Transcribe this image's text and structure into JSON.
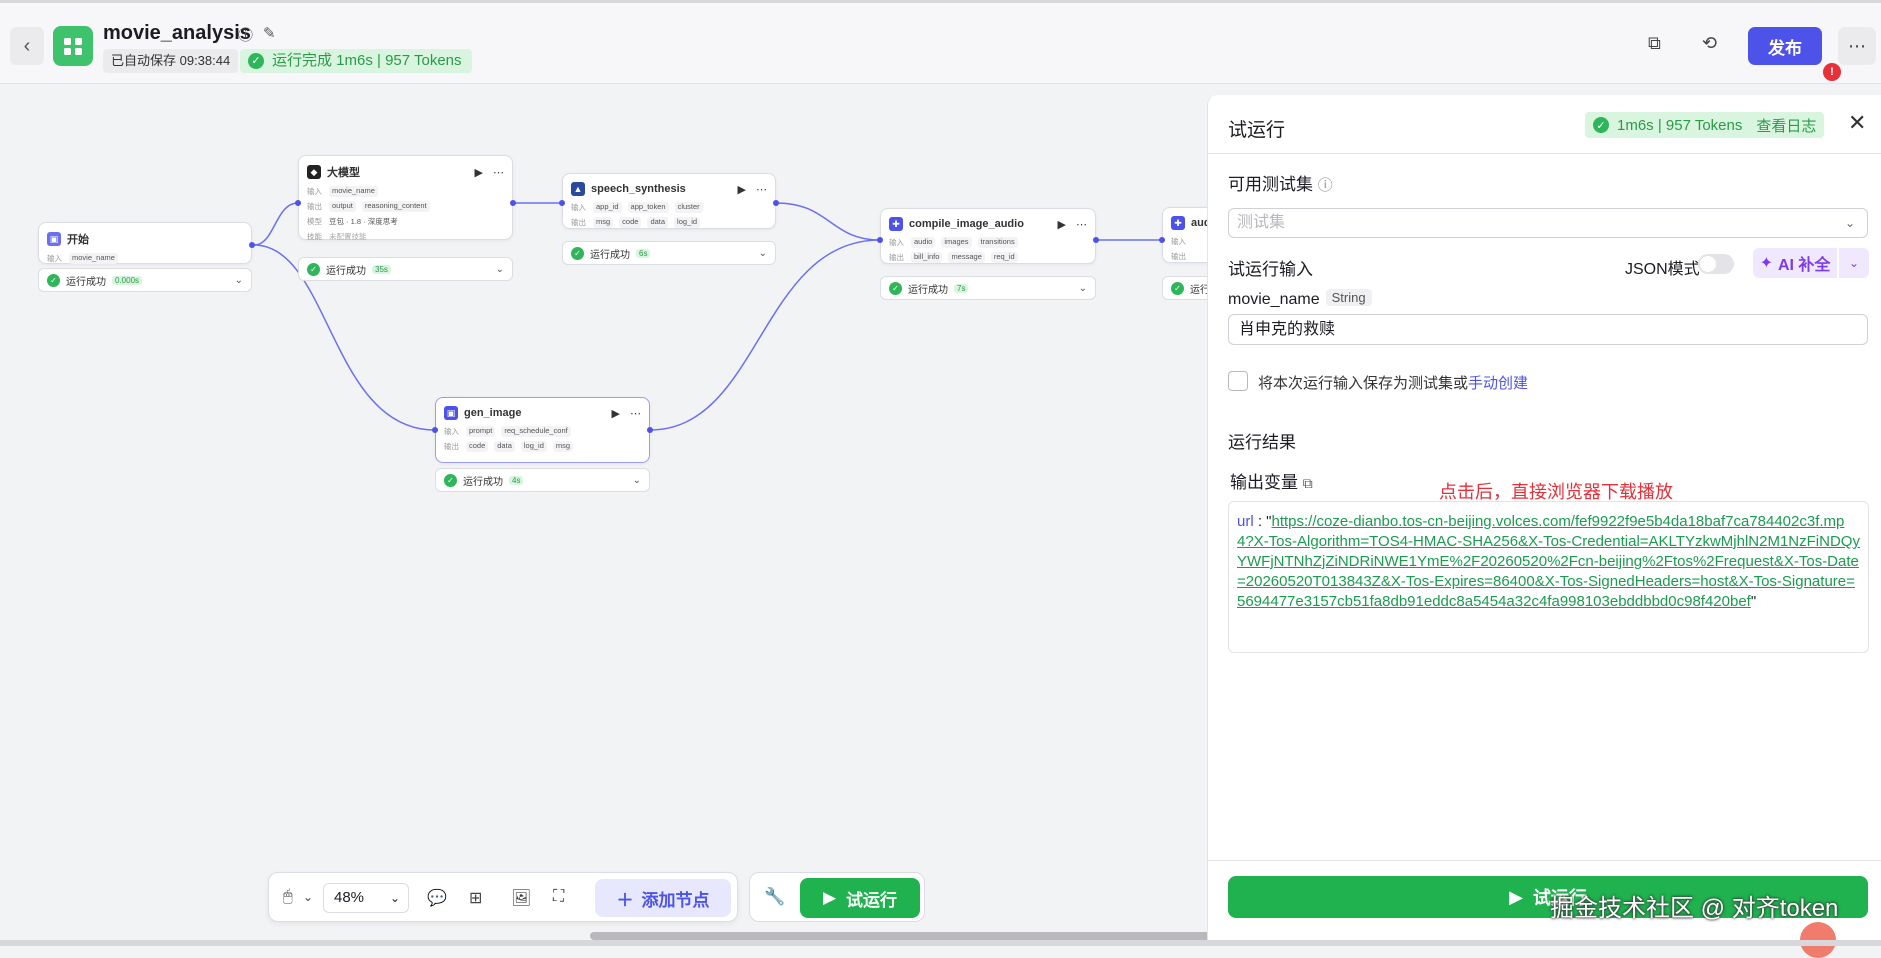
{
  "header": {
    "title": "movie_analysis",
    "autosave": "已自动保存 09:38:44",
    "run_status": "运行完成 1m6s | 957 Tokens",
    "publish": "发布",
    "alert": "!"
  },
  "nodes": {
    "start": {
      "title": "开始",
      "in_label": "输入",
      "in_var": "movie_name",
      "status": "运行成功",
      "time": "0.000s"
    },
    "llm": {
      "title": "大模型",
      "in_label": "输入",
      "in_var": "movie_name",
      "out_label": "输出",
      "out1": "output",
      "out2": "reasoning_content",
      "model_label": "模型",
      "model": "豆包 · 1.8 · 深度思考",
      "skill_label": "技能",
      "skill": "未配置技能",
      "status": "运行成功",
      "time": "35s"
    },
    "speech": {
      "title": "speech_synthesis",
      "in_label": "输入",
      "in1": "app_id",
      "in2": "app_token",
      "in3": "cluster",
      "out_label": "输出",
      "out1": "msg",
      "out2": "code",
      "out3": "data",
      "out4": "log_id",
      "status": "运行成功",
      "time": "6s"
    },
    "compile": {
      "title": "compile_image_audio",
      "in_label": "输入",
      "in1": "audio",
      "in2": "images",
      "in3": "transitions",
      "out_label": "输出",
      "out1": "bill_info",
      "out2": "message",
      "out3": "req_id",
      "status": "运行成功",
      "time": "7s"
    },
    "gen_image": {
      "title": "gen_image",
      "in_label": "输入",
      "in1": "prompt",
      "in2": "req_schedule_conf",
      "out_label": "输出",
      "out1": "code",
      "out2": "data",
      "out3": "log_id",
      "out4": "msg",
      "status": "运行成功",
      "time": "4s"
    },
    "audio": {
      "title": "aud",
      "in_label": "输入",
      "out_label": "输出",
      "status": "运行"
    }
  },
  "toolbar": {
    "zoom": "48%",
    "add_node": "添加节点",
    "run": "试运行"
  },
  "panel": {
    "title": "试运行",
    "stat": "1m6s | 957 Tokens",
    "view_log": "查看日志",
    "testset_label": "可用测试集",
    "testset_placeholder": "测试集",
    "input_label": "试运行输入",
    "json_mode": "JSON模式",
    "ai_fill": "AI 补全",
    "var_name": "movie_name",
    "var_type": "String",
    "var_value": "肖申克的救赎",
    "save_text": "将本次运行输入保存为测试集或",
    "manual_create": "手动创建",
    "result_label": "运行结果",
    "output_label": "输出变量",
    "note": "点击后，直接浏览器下载播放",
    "output_key": "url",
    "output_url": "https://coze-dianbo.tos-cn-beijing.volces.com/fef9922f9e5b4da18baf7ca784402c3f.mp4?X-Tos-Algorithm=TOS4-HMAC-SHA256&X-Tos-Credential=AKLTYzkwMjhlN2M1NzFiNDQyYWFjNTNhZjZiNDRiNWE1YmE%2F20260520%2Fcn-beijing%2Ftos%2Frequest&X-Tos-Date=20260520T013843Z&X-Tos-Expires=86400&X-Tos-SignedHeaders=host&X-Tos-Signature=5694477e3157cb51fa8db91eddc8a5454a32c4fa998103ebddbbd0c98f420bef",
    "run_button": "试运行"
  },
  "watermark": "掘金技术社区 @ 对齐token",
  "colors": {
    "accent": "#4d53e8",
    "success": "#1fb24f",
    "note": "#e6303a",
    "ai": "#7c3ced"
  }
}
